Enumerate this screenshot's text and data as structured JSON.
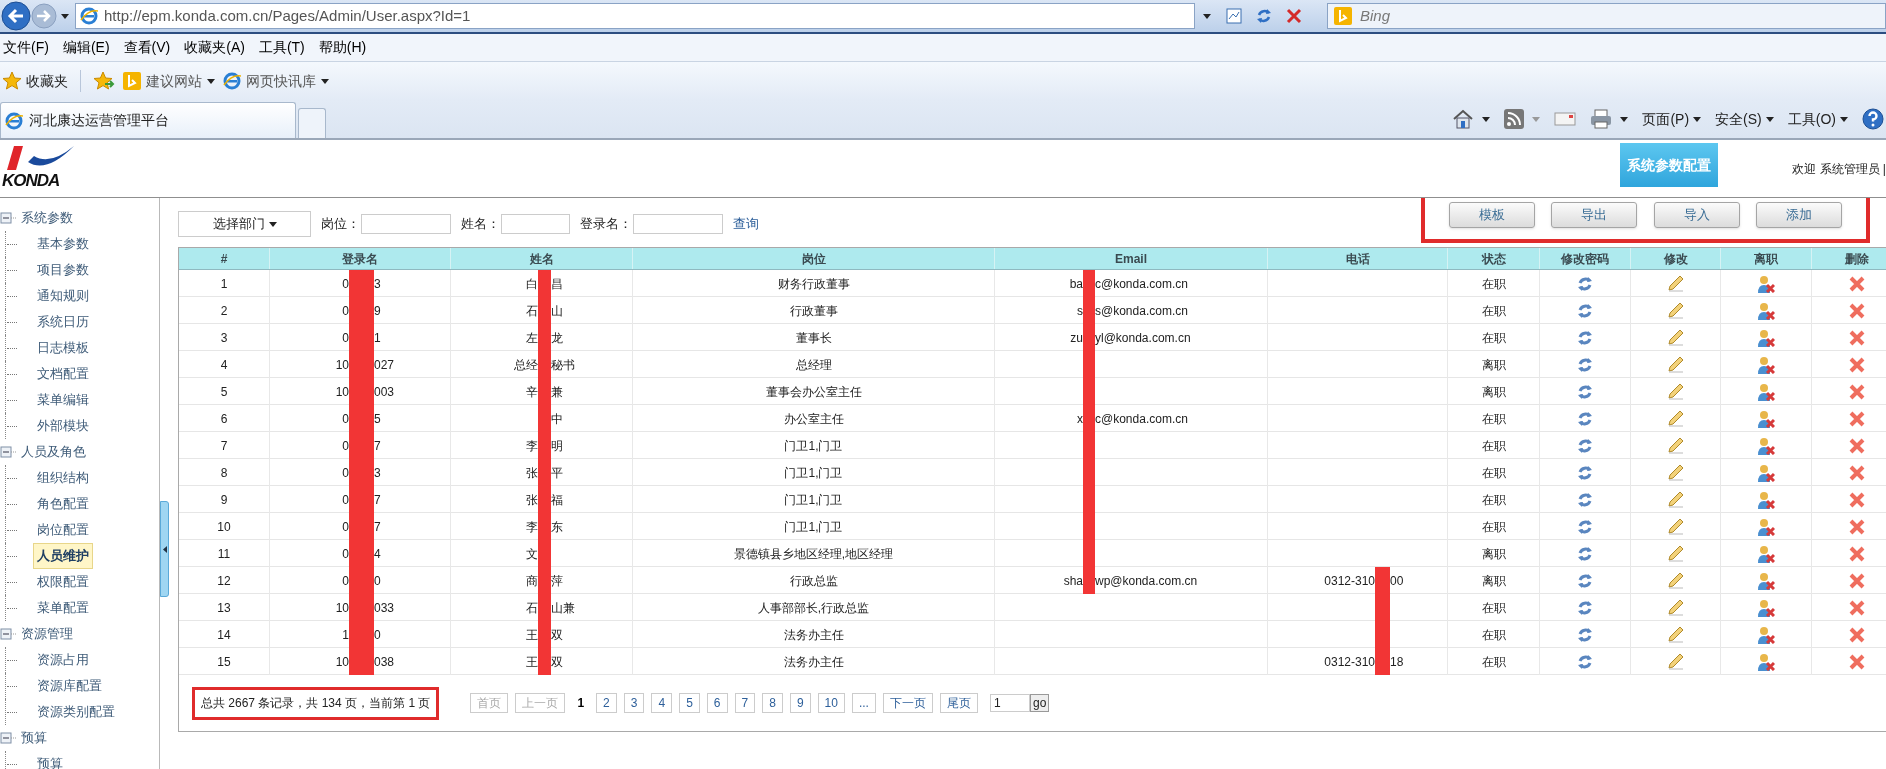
{
  "browser": {
    "address": "http://epm.konda.com.cn/Pages/Admin/User.aspx?Id=1",
    "search_placeholder": "Bing",
    "menu": [
      "文件(F)",
      "编辑(E)",
      "查看(V)",
      "收藏夹(A)",
      "工具(T)",
      "帮助(H)"
    ],
    "favorites": {
      "label": "收藏夹",
      "links": [
        "建议网站",
        "网页快讯库"
      ]
    },
    "tab": "河北康达运营管理平台",
    "commands": [
      "页面(P)",
      "安全(S)",
      "工具(O)"
    ]
  },
  "header": {
    "logo": "KONDA",
    "tab": "系统参数配置",
    "welcome": "欢迎 系统管理员 |"
  },
  "sidebar": [
    {
      "label": "系统参数",
      "expanded": true,
      "children": [
        {
          "label": "基本参数",
          "selected": false
        },
        {
          "label": "项目参数",
          "selected": false
        },
        {
          "label": "通知规则",
          "selected": false
        },
        {
          "label": "系统日历",
          "selected": false
        },
        {
          "label": "日志模板",
          "selected": false
        },
        {
          "label": "文档配置",
          "selected": false
        },
        {
          "label": "菜单编辑",
          "selected": false
        },
        {
          "label": "外部模块",
          "selected": false
        }
      ]
    },
    {
      "label": "人员及角色",
      "expanded": true,
      "children": [
        {
          "label": "组织结构",
          "selected": false
        },
        {
          "label": "角色配置",
          "selected": false
        },
        {
          "label": "岗位配置",
          "selected": false
        },
        {
          "label": "人员维护",
          "selected": true
        },
        {
          "label": "权限配置",
          "selected": false
        },
        {
          "label": "菜单配置",
          "selected": false
        }
      ]
    },
    {
      "label": "资源管理",
      "expanded": true,
      "children": [
        {
          "label": "资源占用",
          "selected": false
        },
        {
          "label": "资源库配置",
          "selected": false
        },
        {
          "label": "资源类别配置",
          "selected": false
        }
      ]
    },
    {
      "label": "预算",
      "expanded": true,
      "children": [
        {
          "label": "预算",
          "selected": false
        }
      ]
    }
  ],
  "filters": {
    "department": "选择部门",
    "fields": [
      "岗位：",
      "姓名：",
      "登录名："
    ],
    "query": "查询"
  },
  "actions": {
    "highlight_box": true,
    "buttons": [
      "模板",
      "导出",
      "导入",
      "添加"
    ]
  },
  "table": {
    "columns": [
      "#",
      "登录名",
      "姓名",
      "岗位",
      "Email",
      "电话",
      "状态",
      "修改密码",
      "修改",
      "离职",
      "删除"
    ],
    "rows": [
      {
        "no": "1",
        "login": {
          "before": "0",
          "after": "3",
          "redacted": true
        },
        "name": {
          "before": "白",
          "after": "昌",
          "redacted": true
        },
        "post": "财务行政董事",
        "email": {
          "before": "ba",
          "after": "c@konda.com.cn",
          "redacted": true
        },
        "phone": {
          "redacted": false
        },
        "status": "在职"
      },
      {
        "no": "2",
        "login": {
          "before": "0",
          "after": "9",
          "redacted": true
        },
        "name": {
          "before": "石",
          "after": "山",
          "redacted": true
        },
        "post": "行政董事",
        "email": {
          "before": "s",
          "after": "s@konda.com.cn",
          "redacted": true
        },
        "phone": {
          "redacted": false
        },
        "status": "在职"
      },
      {
        "no": "3",
        "login": {
          "before": "0",
          "after": "1",
          "redacted": true
        },
        "name": {
          "before": "左",
          "after": "龙",
          "redacted": true
        },
        "post": "董事长",
        "email": {
          "before": "zu",
          "after": "yl@konda.com.cn",
          "redacted": true
        },
        "phone": {
          "redacted": false
        },
        "status": "在职"
      },
      {
        "no": "4",
        "login": {
          "before": "10",
          "after": "027",
          "redacted": true
        },
        "name": {
          "before": "总经",
          "after": "秘书",
          "redacted": true
        },
        "post": "总经理",
        "email": {
          "redacted": true
        },
        "phone": {
          "redacted": false
        },
        "status": "离职"
      },
      {
        "no": "5",
        "login": {
          "before": "10",
          "after": "003",
          "redacted": true
        },
        "name": {
          "before": "辛",
          "after": "兼",
          "redacted": true
        },
        "post": "董事会办公室主任",
        "email": {
          "redacted": true
        },
        "phone": {
          "redacted": false
        },
        "status": "离职"
      },
      {
        "no": "6",
        "login": {
          "before": "0",
          "after": "5",
          "redacted": true
        },
        "name": {
          "after": "中",
          "redacted": true
        },
        "post": "办公室主任",
        "email": {
          "before": "x",
          "after": "c@konda.com.cn",
          "redacted": true
        },
        "phone": {
          "redacted": false
        },
        "status": "在职"
      },
      {
        "no": "7",
        "login": {
          "before": "0",
          "after": "7",
          "redacted": true
        },
        "name": {
          "before": "李",
          "after": "明",
          "redacted": true
        },
        "post": "门卫1,门卫",
        "email": {
          "redacted": true
        },
        "phone": {
          "redacted": false
        },
        "status": "在职"
      },
      {
        "no": "8",
        "login": {
          "before": "0",
          "after": "3",
          "redacted": true
        },
        "name": {
          "before": "张",
          "after": "平",
          "redacted": true
        },
        "post": "门卫1,门卫",
        "email": {
          "redacted": true
        },
        "phone": {
          "redacted": false
        },
        "status": "在职"
      },
      {
        "no": "9",
        "login": {
          "before": "0",
          "after": "7",
          "redacted": true
        },
        "name": {
          "before": "张",
          "after": "福",
          "redacted": true
        },
        "post": "门卫1,门卫",
        "email": {
          "redacted": true
        },
        "phone": {
          "redacted": false
        },
        "status": "在职"
      },
      {
        "no": "10",
        "login": {
          "before": "0",
          "after": "7",
          "redacted": true
        },
        "name": {
          "before": "李",
          "after": "东",
          "redacted": true
        },
        "post": "门卫1,门卫",
        "email": {
          "redacted": true
        },
        "phone": {
          "redacted": false
        },
        "status": "在职"
      },
      {
        "no": "11",
        "login": {
          "before": "0",
          "after": "4",
          "redacted": true
        },
        "name": {
          "before": "文",
          "redacted": true
        },
        "post": "景德镇县乡地区经理,地区经理",
        "email": {
          "redacted": true
        },
        "phone": {
          "redacted": false
        },
        "status": "离职"
      },
      {
        "no": "12",
        "login": {
          "before": "0",
          "after": "0",
          "redacted": true
        },
        "name": {
          "before": "商",
          "after": "萍",
          "redacted": true
        },
        "post": "行政总监",
        "email": {
          "before": "sha",
          "after": "wp@konda.com.cn",
          "redacted": true
        },
        "phone": {
          "before": "0312-310",
          "after": "00",
          "redacted": true
        },
        "status": "离职"
      },
      {
        "no": "13",
        "login": {
          "before": "10",
          "after": "033",
          "redacted": true
        },
        "name": {
          "before": "石",
          "after": "山兼",
          "redacted": true
        },
        "post": "人事部部长,行政总监",
        "email": {
          "redacted": false
        },
        "phone": {
          "redacted": true
        },
        "status": "在职"
      },
      {
        "no": "14",
        "login": {
          "before": "1",
          "after": "0",
          "redacted": true
        },
        "name": {
          "before": "王",
          "after": "双",
          "redacted": true
        },
        "post": "法务办主任",
        "email": {
          "redacted": false
        },
        "phone": {
          "redacted": true
        },
        "status": "在职"
      },
      {
        "no": "15",
        "login": {
          "before": "10",
          "after": "038",
          "redacted": true
        },
        "name": {
          "before": "王",
          "after": "双",
          "redacted": true
        },
        "post": "法务办主任",
        "email": {
          "redacted": false
        },
        "phone": {
          "before": "0312-310",
          "after": "18",
          "redacted": true
        },
        "status": "在职"
      }
    ]
  },
  "pager": {
    "summary": "总共 2667 条记录，共 134 页，当前第 1 页",
    "highlight_box": true,
    "pages": [
      {
        "label": "首页",
        "kind": "disabled"
      },
      {
        "label": "上一页",
        "kind": "disabled"
      },
      {
        "label": "1",
        "kind": "current"
      },
      {
        "label": "2",
        "kind": "page"
      },
      {
        "label": "3",
        "kind": "page"
      },
      {
        "label": "4",
        "kind": "page"
      },
      {
        "label": "5",
        "kind": "page"
      },
      {
        "label": "6",
        "kind": "page"
      },
      {
        "label": "7",
        "kind": "page"
      },
      {
        "label": "8",
        "kind": "page"
      },
      {
        "label": "9",
        "kind": "page"
      },
      {
        "label": "10",
        "kind": "page"
      },
      {
        "label": "...",
        "kind": "page"
      },
      {
        "label": "下一页",
        "kind": "page"
      },
      {
        "label": "尾页",
        "kind": "page"
      }
    ],
    "page_input": "1",
    "go": "go"
  }
}
